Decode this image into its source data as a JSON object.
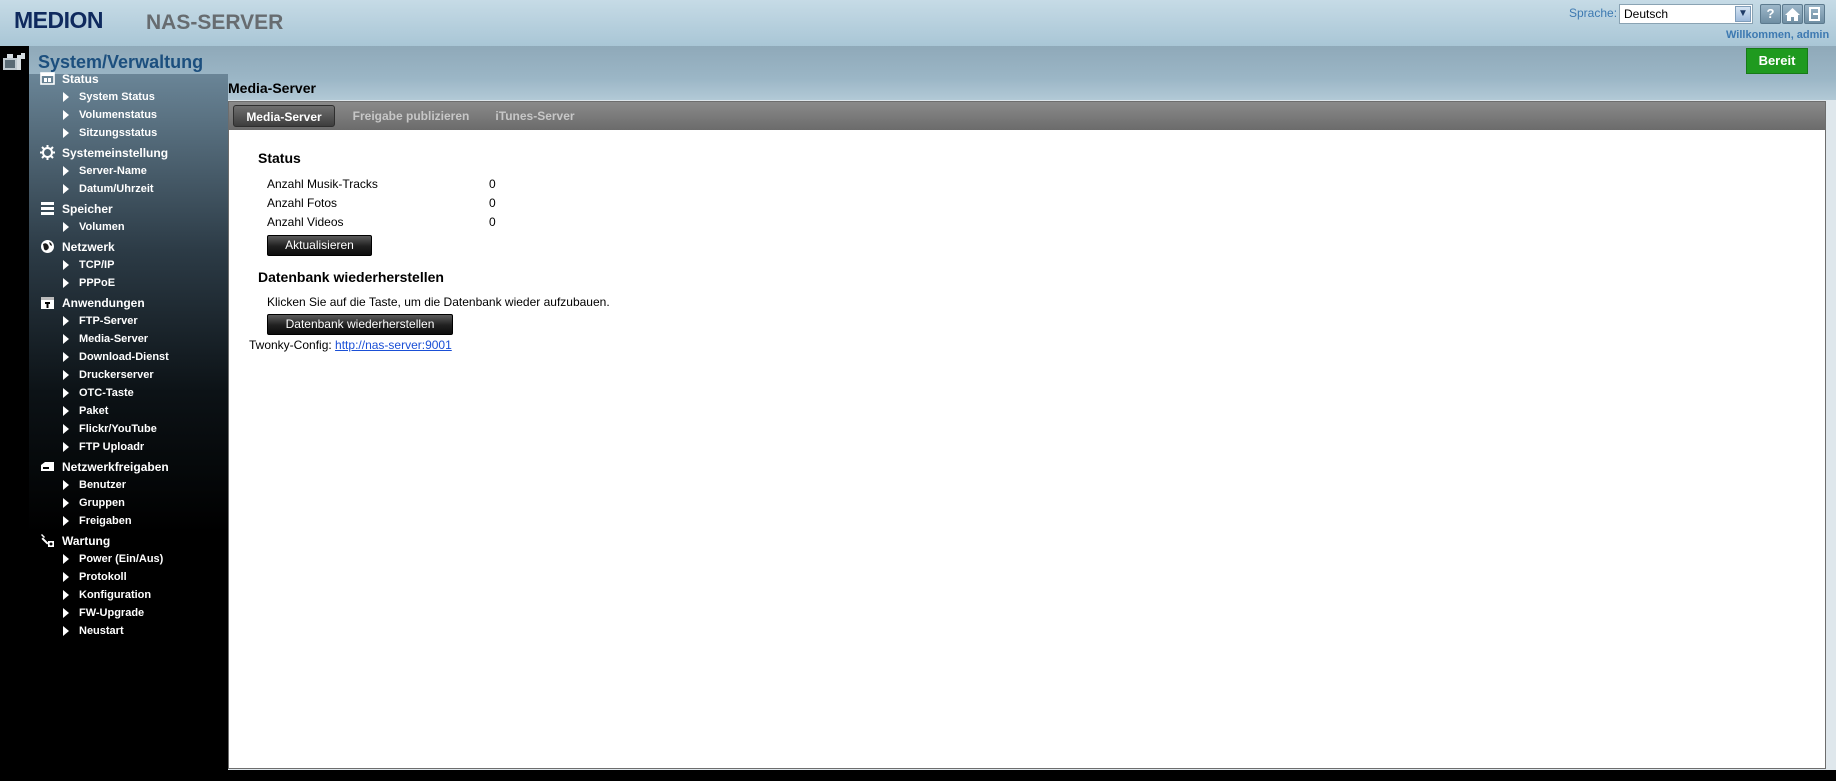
{
  "header": {
    "brand": "MEDION",
    "product": "NAS-SERVER",
    "language_label": "Sprache:",
    "language_value": "Deutsch",
    "icons": [
      "help-icon",
      "home-icon",
      "logout-icon"
    ],
    "welcome": "Willkommen, admin"
  },
  "title_band": {
    "title": "System/Verwaltung",
    "ready_label": "Bereit",
    "ready_color": "#1f9a1f"
  },
  "sidebar": {
    "sections": [
      {
        "label": "Status",
        "icon": "status-icon",
        "items": [
          "System Status",
          "Volumenstatus",
          "Sitzungsstatus"
        ]
      },
      {
        "label": "Systemeinstellung",
        "icon": "gear-icon",
        "items": [
          "Server-Name",
          "Datum/Uhrzeit"
        ]
      },
      {
        "label": "Speicher",
        "icon": "storage-icon",
        "items": [
          "Volumen"
        ]
      },
      {
        "label": "Netzwerk",
        "icon": "globe-icon",
        "items": [
          "TCP/IP",
          "PPPoE"
        ]
      },
      {
        "label": "Anwendungen",
        "icon": "applications-icon",
        "items": [
          "FTP-Server",
          "Media-Server",
          "Download-Dienst",
          "Druckerserver",
          "OTC-Taste",
          "Paket",
          "Flickr/YouTube",
          "FTP Uploadr"
        ]
      },
      {
        "label": "Netzwerkfreigaben",
        "icon": "network-share-icon",
        "items": [
          "Benutzer",
          "Gruppen",
          "Freigaben"
        ]
      },
      {
        "label": "Wartung",
        "icon": "maintenance-icon",
        "items": [
          "Power (Ein/Aus)",
          "Protokoll",
          "Konfiguration",
          "FW-Upgrade",
          "Neustart"
        ]
      }
    ]
  },
  "content": {
    "heading": "Media-Server",
    "tabs": [
      {
        "label": "Media-Server",
        "active": true
      },
      {
        "label": "Freigabe publizieren",
        "active": false
      },
      {
        "label": "iTunes-Server",
        "active": false
      }
    ],
    "status": {
      "title": "Status",
      "rows": [
        {
          "label": "Anzahl Musik-Tracks",
          "value": "0"
        },
        {
          "label": "Anzahl Fotos",
          "value": "0"
        },
        {
          "label": "Anzahl Videos",
          "value": "0"
        }
      ],
      "refresh_label": "Aktualisieren"
    },
    "restore": {
      "title": "Datenbank wiederherstellen",
      "description": "Klicken Sie auf die Taste, um die Datenbank wieder aufzubauen.",
      "button_label": "Datenbank wiederherstellen"
    },
    "twonky": {
      "label": "Twonky-Config:",
      "link": "http://nas-server:9001"
    }
  }
}
